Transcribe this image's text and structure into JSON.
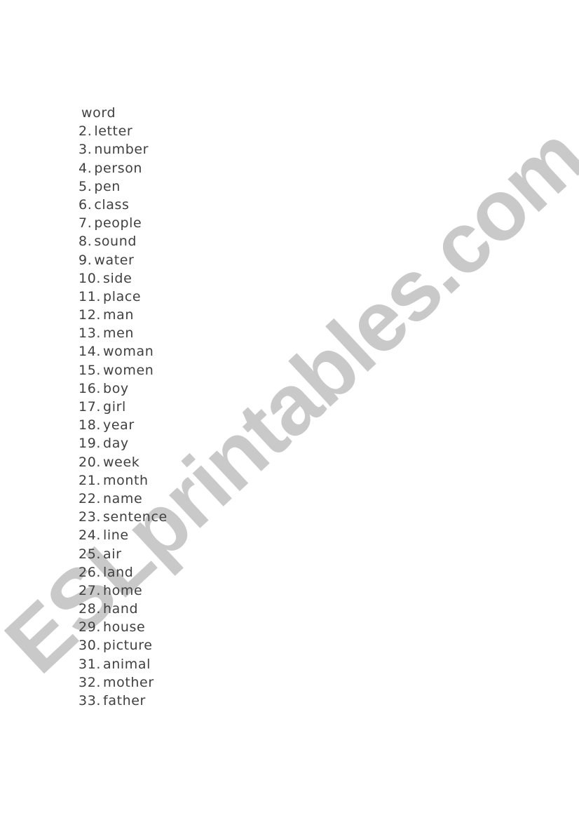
{
  "watermark": "ESLprintables.com",
  "header_word": "word",
  "items": [
    {
      "num": "2.",
      "word": "letter"
    },
    {
      "num": "3.",
      "word": "number"
    },
    {
      "num": "4.",
      "word": "person"
    },
    {
      "num": "5.",
      "word": "pen"
    },
    {
      "num": "6.",
      "word": "class"
    },
    {
      "num": "7.",
      "word": "people"
    },
    {
      "num": "8.",
      "word": "sound"
    },
    {
      "num": "9.",
      "word": "water"
    },
    {
      "num": "10.",
      "word": "side"
    },
    {
      "num": "11.",
      "word": "place"
    },
    {
      "num": "12.",
      "word": "man"
    },
    {
      "num": "13.",
      "word": "men"
    },
    {
      "num": "14.",
      "word": "woman"
    },
    {
      "num": "15.",
      "word": "women"
    },
    {
      "num": "16.",
      "word": "boy"
    },
    {
      "num": "17.",
      "word": "girl"
    },
    {
      "num": "18.",
      "word": "year"
    },
    {
      "num": "19.",
      "word": "day"
    },
    {
      "num": "20.",
      "word": "week"
    },
    {
      "num": "21.",
      "word": "month"
    },
    {
      "num": "22.",
      "word": "name"
    },
    {
      "num": "23.",
      "word": "sentence"
    },
    {
      "num": "24.",
      "word": "line"
    },
    {
      "num": "25.",
      "word": "air"
    },
    {
      "num": "26.",
      "word": "land"
    },
    {
      "num": "27.",
      "word": "home"
    },
    {
      "num": "28.",
      "word": "hand"
    },
    {
      "num": "29.",
      "word": "house"
    },
    {
      "num": "30.",
      "word": "picture"
    },
    {
      "num": "31.",
      "word": "animal"
    },
    {
      "num": "32.",
      "word": "mother"
    },
    {
      "num": "33.",
      "word": "father"
    }
  ]
}
